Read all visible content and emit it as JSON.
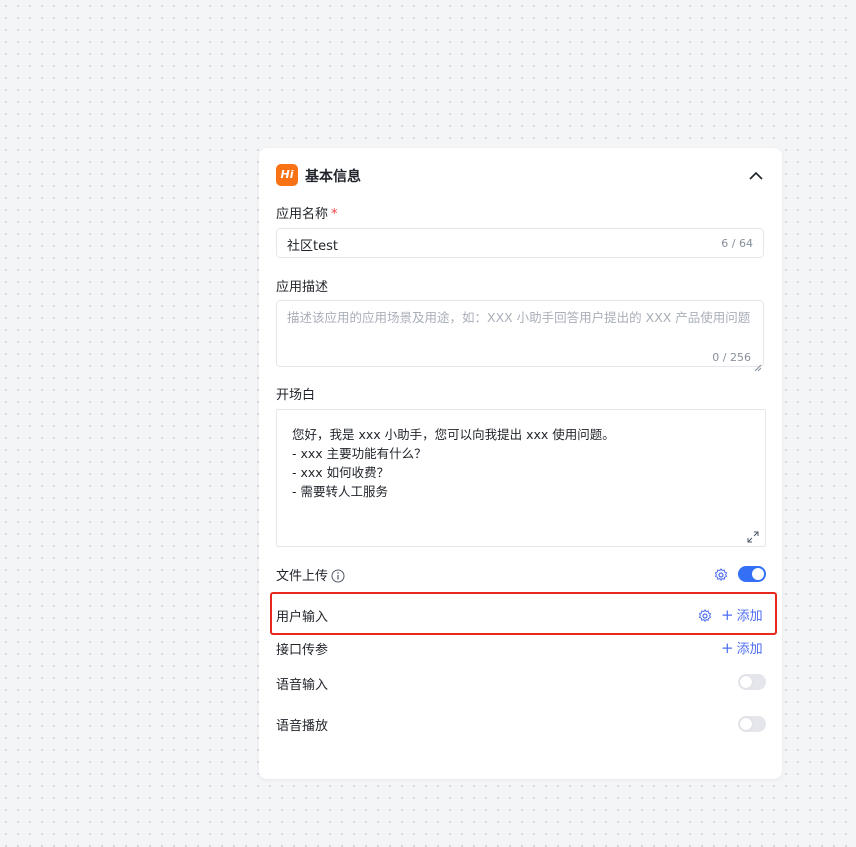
{
  "header": {
    "logo_text": "Hi",
    "title": "基本信息",
    "collapse_icon": "chevron-up-icon"
  },
  "app_name": {
    "label": "应用名称",
    "required_mark": "*",
    "value": "社区test",
    "count": "6 / 64"
  },
  "app_desc": {
    "label": "应用描述",
    "placeholder": "描述该应用的应用场景及用途，如：XXX 小助手回答用户提出的 XXX 产品使用问题",
    "count": "0 / 256"
  },
  "opening": {
    "label": "开场白",
    "lines": [
      "您好，我是 xxx 小助手，您可以向我提出 xxx 使用问题。",
      "- xxx 主要功能有什么？",
      "- xxx 如何收费？",
      "- 需要转人工服务"
    ],
    "expand_icon": "expand-icon"
  },
  "file_upload": {
    "label": "文件上传",
    "enabled": true
  },
  "user_input": {
    "label": "用户输入",
    "add_label": "添加"
  },
  "api_params": {
    "label": "接口传参",
    "add_label": "添加"
  },
  "voice_input": {
    "label": "语音输入",
    "enabled": false
  },
  "voice_play": {
    "label": "语音播放",
    "enabled": false
  },
  "colors": {
    "accent": "#3470f5",
    "link": "#4e6ef2",
    "logo": "#f97316",
    "highlight": "#e8281c"
  }
}
